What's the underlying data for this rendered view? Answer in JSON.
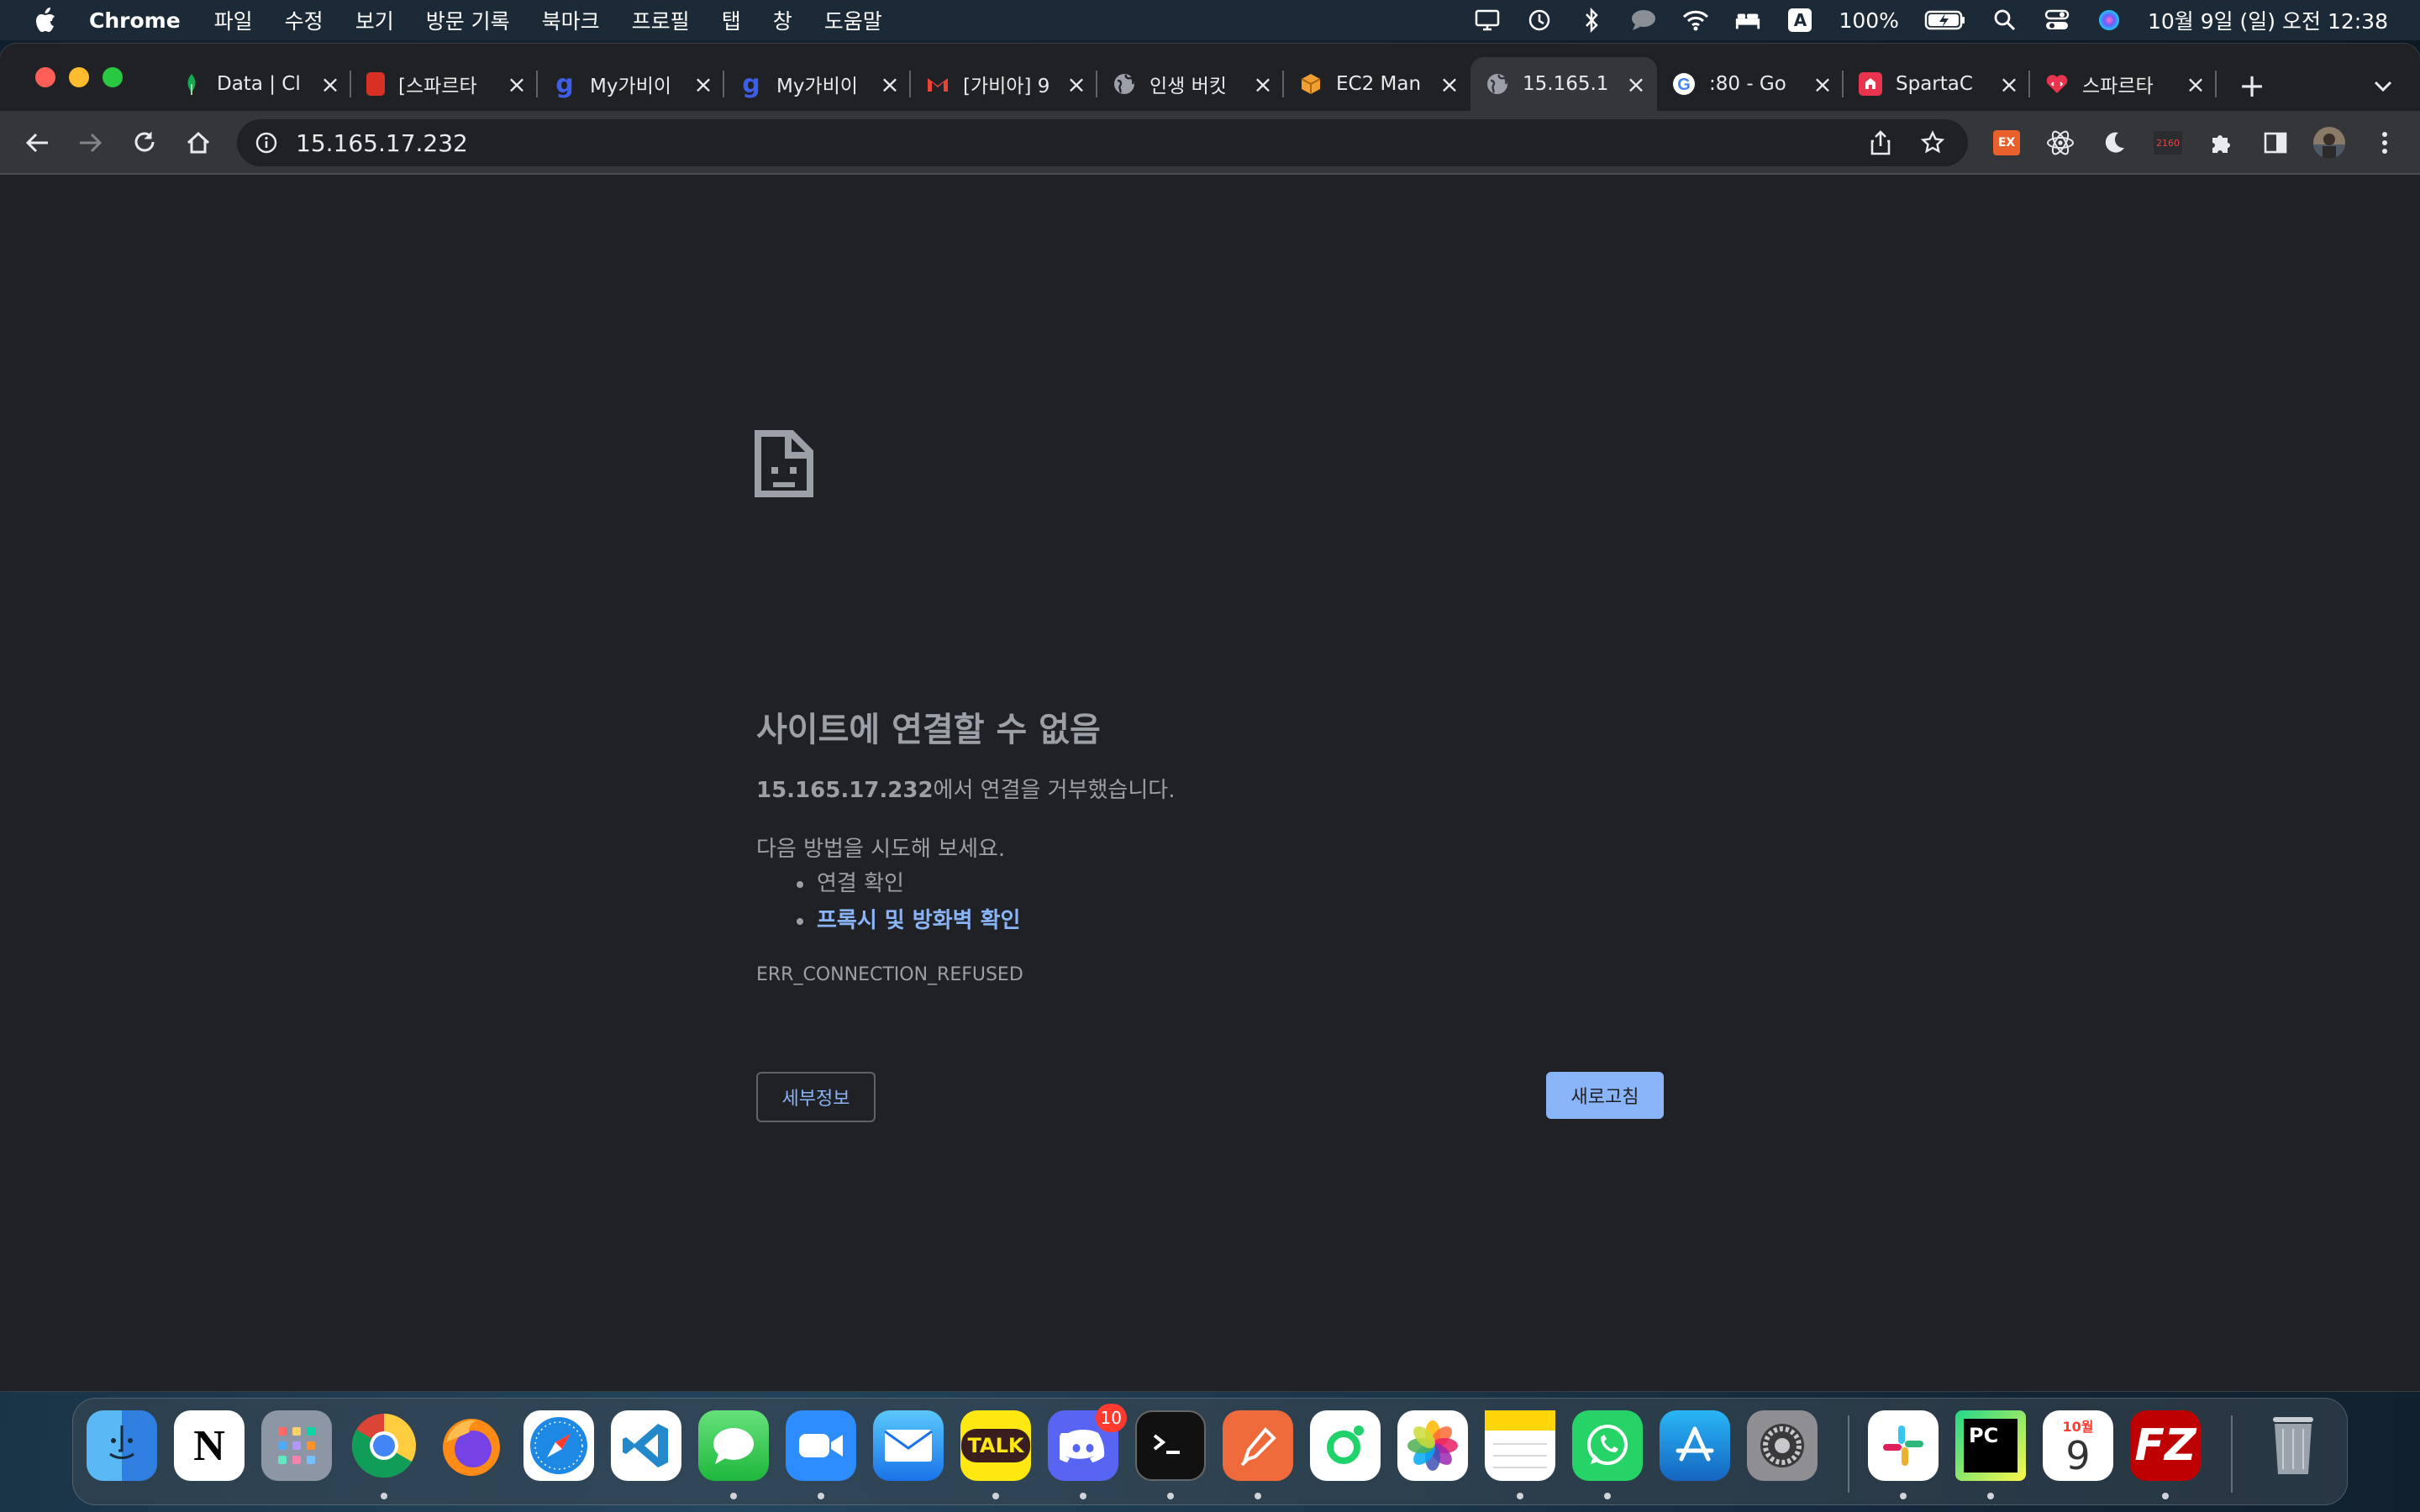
{
  "menubar": {
    "app_name": "Chrome",
    "items": [
      "파일",
      "수정",
      "보기",
      "방문 기록",
      "북마크",
      "프로필",
      "탭",
      "창",
      "도움말"
    ],
    "battery": "100%",
    "input_source": "A",
    "clock": "10월 9일 (일) 오전 12:38"
  },
  "tabs": [
    {
      "title": "Data | Cl",
      "icon": "leaf-icon",
      "color": "#13aa52"
    },
    {
      "title": "[스파르타",
      "icon": "book-icon",
      "color": "#d93025"
    },
    {
      "title": "My가비이",
      "icon": "g-logo-icon",
      "color": "#3c5ee8"
    },
    {
      "title": "My가비이",
      "icon": "g-logo-icon",
      "color": "#3c5ee8"
    },
    {
      "title": "[가비아] 9",
      "icon": "gmail-icon",
      "color": "#ea4335"
    },
    {
      "title": "인생 버킷",
      "icon": "globe-icon",
      "color": "#9aa0a6"
    },
    {
      "title": "EC2 Man",
      "icon": "box-icon",
      "color": "#f0a030"
    },
    {
      "title": "15.165.1",
      "icon": "globe-icon",
      "color": "#9aa0a6",
      "active": true
    },
    {
      "title": ":80 - Go",
      "icon": "google-icon",
      "color": "#4285f4"
    },
    {
      "title": "SpartaC",
      "icon": "sparta-icon",
      "color": "#e8344e"
    },
    {
      "title": "스파르타",
      "icon": "heart-code-icon",
      "color": "#e8344e"
    }
  ],
  "omnibox": {
    "url": "15.165.17.232"
  },
  "extensions": {
    "ex_label": "EX",
    "counter_label": "2160"
  },
  "error": {
    "heading": "사이트에 연결할 수 없음",
    "host": "15.165.17.232",
    "refused_suffix": "에서 연결을 거부했습니다.",
    "try_intro": "다음 방법을 시도해 보세요.",
    "suggestions": [
      "연결 확인",
      "프록시 및 방화벽 확인"
    ],
    "code": "ERR_CONNECTION_REFUSED",
    "details_button": "세부정보",
    "reload_button": "새로고침"
  },
  "dock": {
    "discord_badge": "10",
    "calendar_month": "10월",
    "calendar_day": "9",
    "notion_letter": "N",
    "kakao_label": "TALK",
    "pycharm_label": "PC",
    "filezilla_label": "FZ"
  }
}
